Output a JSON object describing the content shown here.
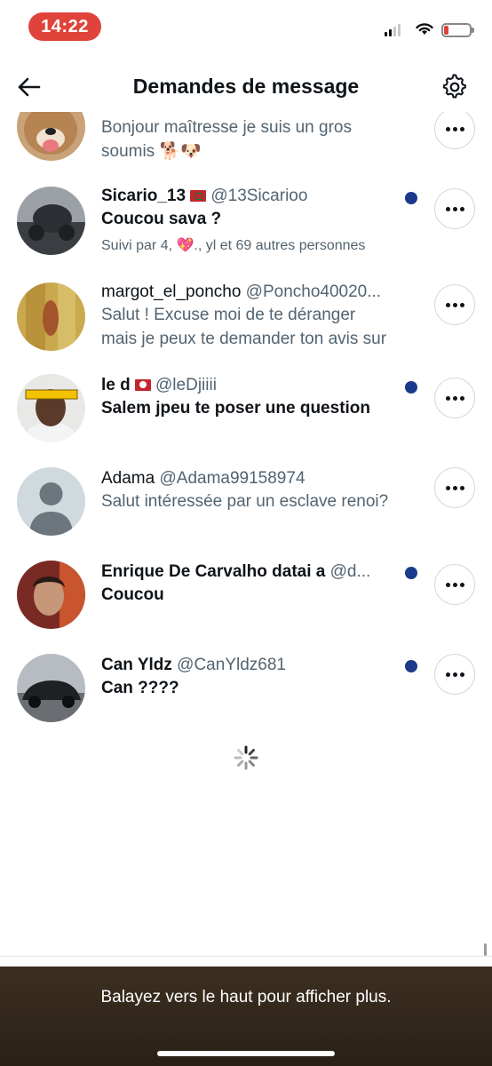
{
  "status_bar": {
    "time": "14:22"
  },
  "header": {
    "title": "Demandes de message"
  },
  "requests": [
    {
      "name": "",
      "handle": "",
      "message": "Bonjour maîtresse je suis un gros soumis 🐕🐶",
      "followed_by": "",
      "unread": false
    },
    {
      "name": "Sicario_13",
      "handle": "@13Sicarioo",
      "message": "Coucou sava ?",
      "followed_by": "Suivi par 4, 💖., yl et 69 autres personnes",
      "unread": true
    },
    {
      "name": "margot_el_poncho",
      "handle": "@Poncho40020...",
      "message": "Salut ! Excuse moi de te déranger mais je peux te demander ton avis sur",
      "followed_by": "",
      "unread": false
    },
    {
      "name": "le d",
      "handle": "@leDjiiii",
      "message": "Salem jpeu te poser une question",
      "followed_by": "",
      "unread": true
    },
    {
      "name": "Adama",
      "handle": "@Adama99158974",
      "message": "Salut intéressée par un esclave renoi?",
      "followed_by": "",
      "unread": false
    },
    {
      "name": "Enrique De Carvalho datai a",
      "handle": "@d...",
      "message": "Coucou",
      "followed_by": "",
      "unread": true
    },
    {
      "name": "Can Yldz",
      "handle": "@CanYldz681",
      "message": "Can ????",
      "followed_by": "",
      "unread": true
    }
  ],
  "footer": {
    "hint": "Balayez vers le haut pour afficher plus."
  },
  "colors": {
    "unread_dot": "#1c3a8c",
    "time_pill": "#e0433a",
    "secondary_text": "#536471"
  }
}
